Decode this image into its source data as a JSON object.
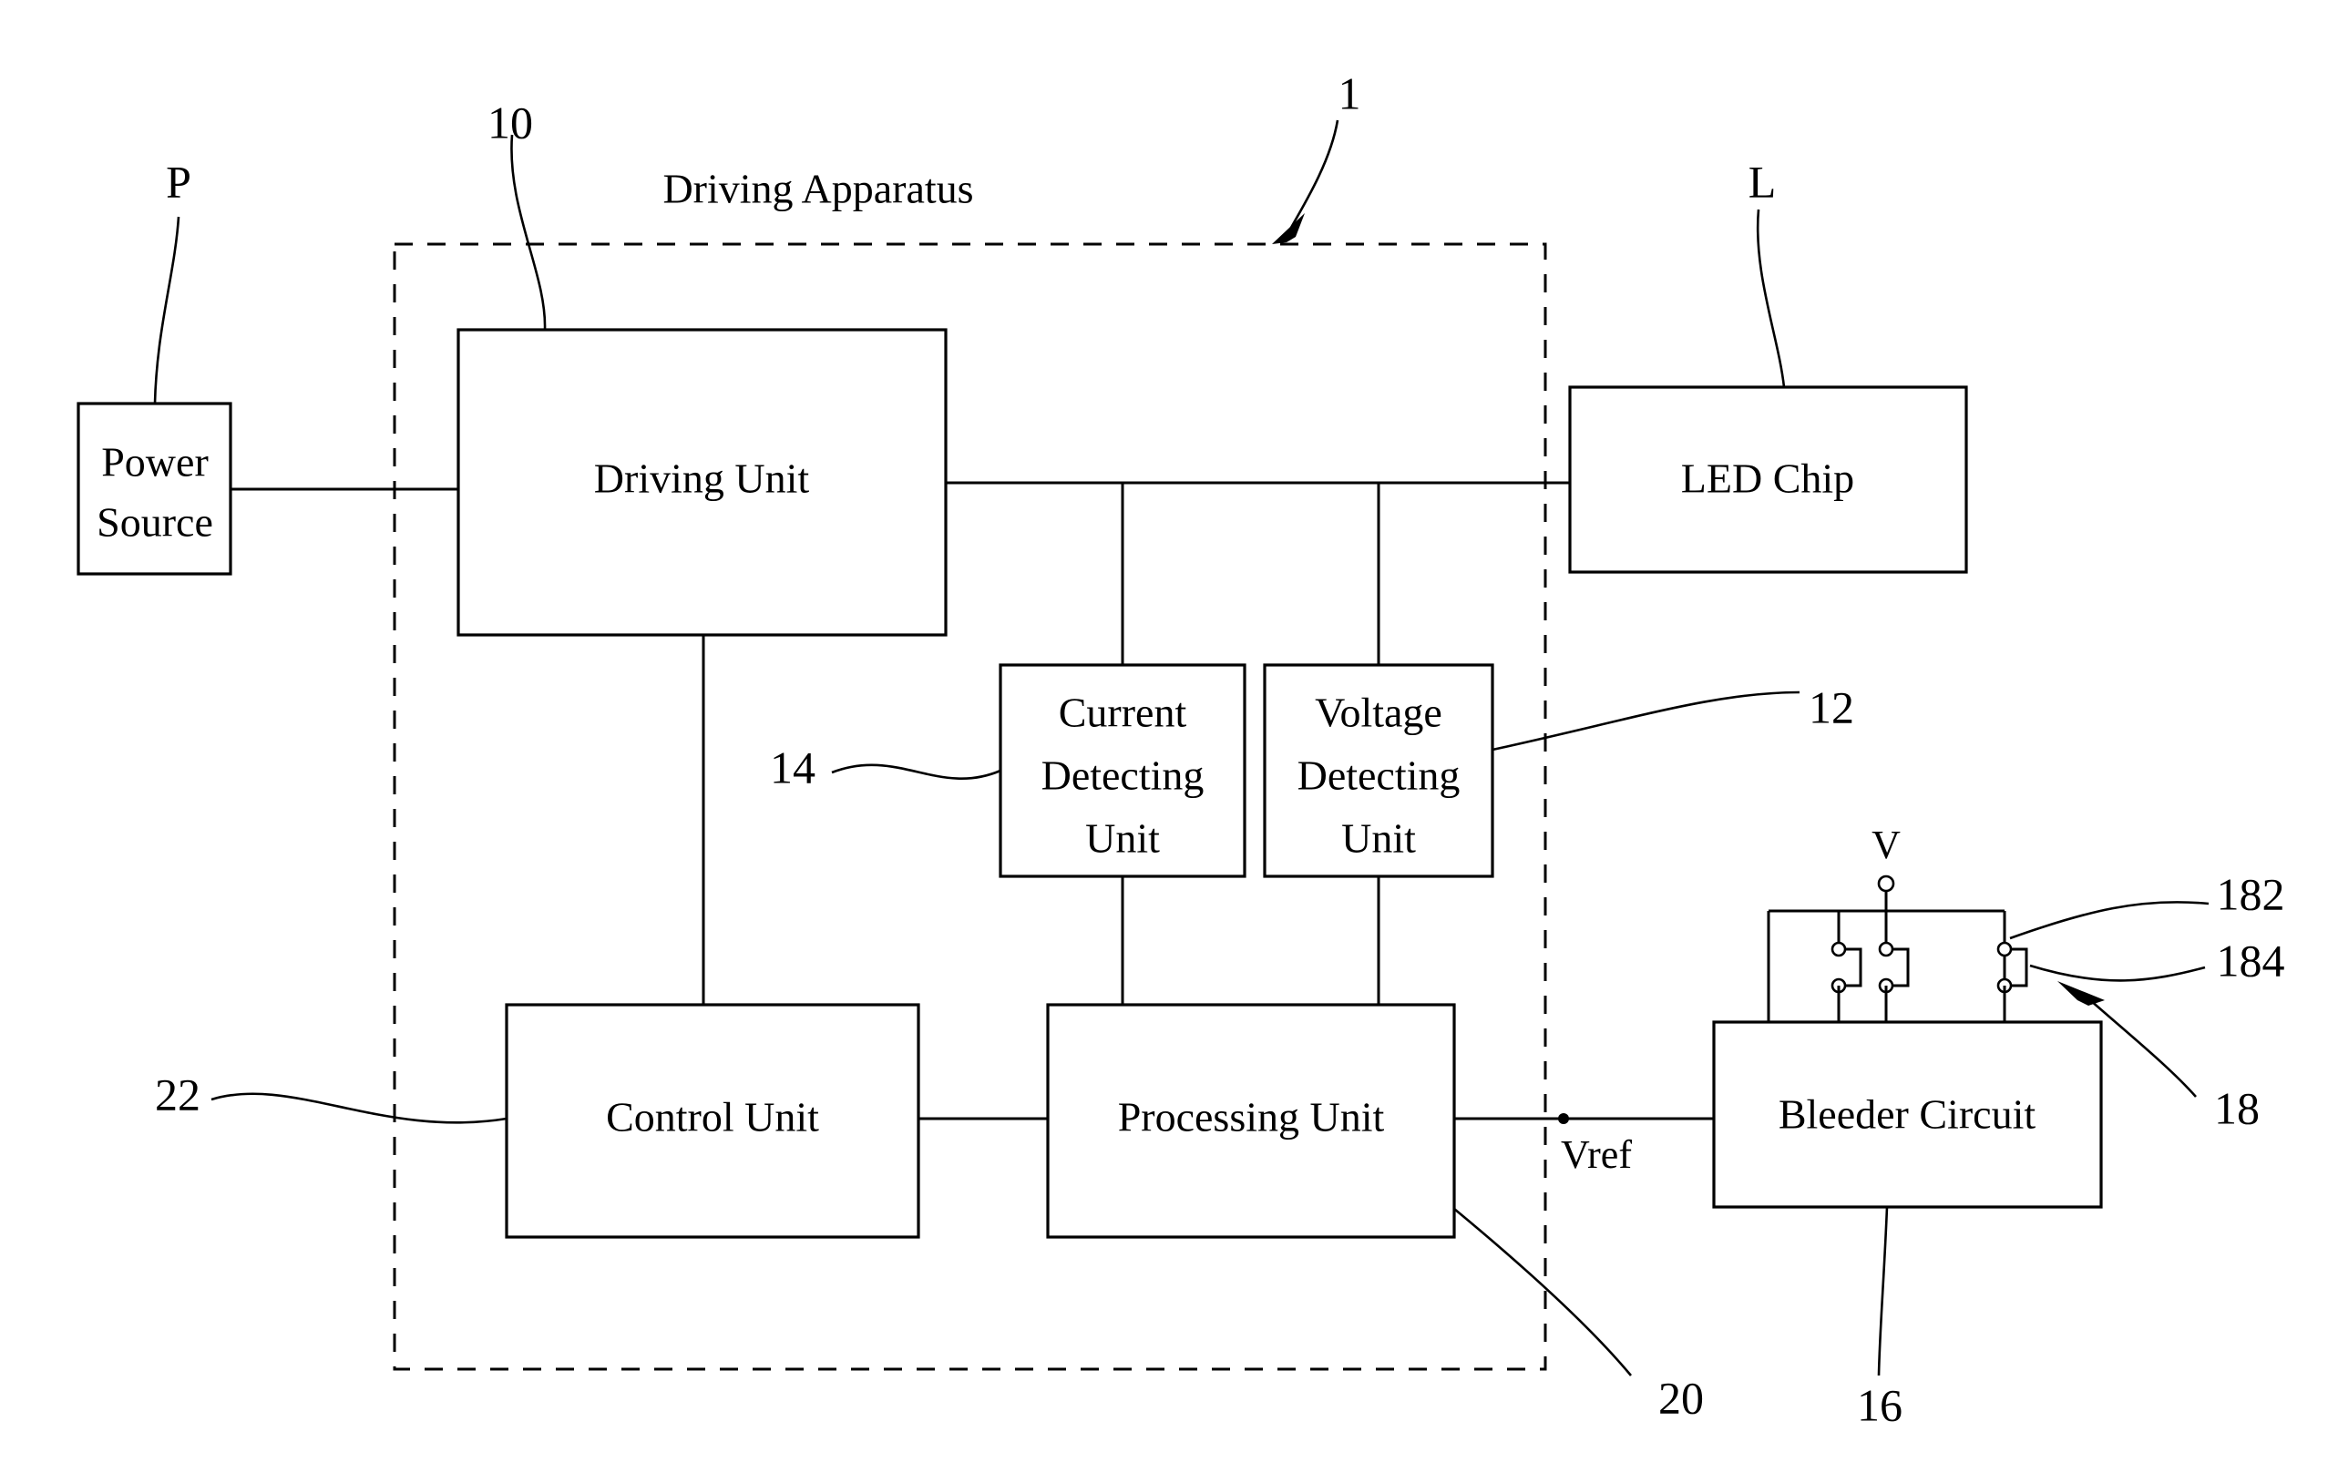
{
  "figure": {
    "title": "Driving Apparatus",
    "domain_kind": "patent-block-diagram"
  },
  "blocks": {
    "power_source": {
      "label_line1": "Power",
      "label_line2": "Source"
    },
    "driving_unit": {
      "label": "Driving Unit"
    },
    "led_chip": {
      "label": "LED Chip"
    },
    "current_detecting_unit": {
      "label_line1": "Current",
      "label_line2": "Detecting",
      "label_line3": "Unit"
    },
    "voltage_detecting_unit": {
      "label_line1": "Voltage",
      "label_line2": "Detecting",
      "label_line3": "Unit"
    },
    "control_unit": {
      "label": "Control Unit"
    },
    "processing_unit": {
      "label": "Processing Unit"
    },
    "bleeder_circuit": {
      "label": "Bleeder Circuit"
    }
  },
  "signals": {
    "vref": "Vref",
    "v_node": "V"
  },
  "reference_numerals": {
    "apparatus": "1",
    "driving_unit": "10",
    "voltage_detecting_unit": "12",
    "current_detecting_unit": "14",
    "bleeder_circuit": "16",
    "switch_group": "18",
    "switch_first": "182",
    "switch_second": "184",
    "processing_unit": "20",
    "control_unit": "22",
    "power_source": "P",
    "led_load": "L"
  },
  "colors": {
    "ink": "#000000",
    "paper": "#ffffff"
  }
}
